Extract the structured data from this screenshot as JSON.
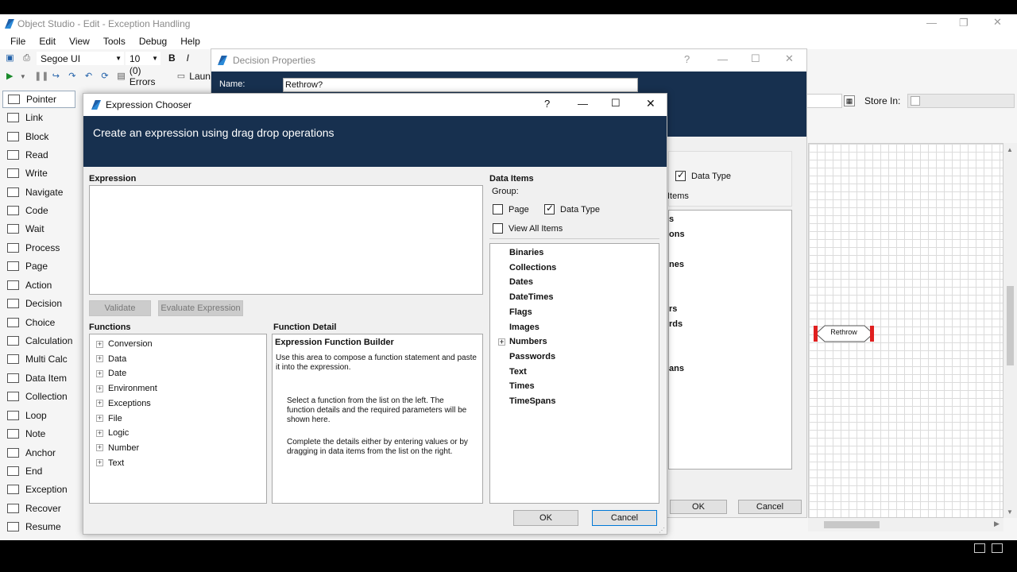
{
  "app": {
    "title": "Object Studio - Edit - Exception Handling",
    "menu": [
      "File",
      "Edit",
      "View",
      "Tools",
      "Debug",
      "Help"
    ],
    "font_name": "Segoe UI",
    "font_size": "10",
    "bold": "B",
    "italic": "I",
    "errors": "(0) Errors",
    "launch": "Laun"
  },
  "palette": [
    {
      "label": "Pointer",
      "icon": "pointer-icon",
      "selected": true
    },
    {
      "label": "Link",
      "icon": "link-icon"
    },
    {
      "label": "Block",
      "icon": "block-icon"
    },
    {
      "label": "Read",
      "icon": "read-icon"
    },
    {
      "label": "Write",
      "icon": "write-icon"
    },
    {
      "label": "Navigate",
      "icon": "navigate-icon"
    },
    {
      "label": "Code",
      "icon": "code-icon"
    },
    {
      "label": "Wait",
      "icon": "wait-icon"
    },
    {
      "label": "Process",
      "icon": "process-icon"
    },
    {
      "label": "Page",
      "icon": "page-icon"
    },
    {
      "label": "Action",
      "icon": "action-icon"
    },
    {
      "label": "Decision",
      "icon": "decision-icon"
    },
    {
      "label": "Choice",
      "icon": "choice-icon"
    },
    {
      "label": "Calculation",
      "icon": "calculation-icon"
    },
    {
      "label": "Multi Calc",
      "icon": "multi-calc-icon"
    },
    {
      "label": "Data Item",
      "icon": "data-item-icon"
    },
    {
      "label": "Collection",
      "icon": "collection-icon"
    },
    {
      "label": "Loop",
      "icon": "loop-icon"
    },
    {
      "label": "Note",
      "icon": "note-icon"
    },
    {
      "label": "Anchor",
      "icon": "anchor-icon"
    },
    {
      "label": "End",
      "icon": "end-icon"
    },
    {
      "label": "Exception",
      "icon": "exception-icon"
    },
    {
      "label": "Recover",
      "icon": "recover-icon"
    },
    {
      "label": "Resume",
      "icon": "resume-icon"
    }
  ],
  "decision": {
    "title": "Decision Properties",
    "name_label": "Name:",
    "name_value": "Rethrow?",
    "help": "?",
    "store_in": "Store In:",
    "data_type": "Data Type",
    "items_partial": "Items",
    "side_fragments": [
      "ons",
      "nes",
      "rs",
      "rds",
      "ans"
    ],
    "ok": "OK",
    "cancel": "Cancel",
    "stage_label": "Rethrow"
  },
  "chooser": {
    "title": "Expression Chooser",
    "help": "?",
    "header": "Create an expression using drag drop operations",
    "expression_label": "Expression",
    "validate": "Validate",
    "evaluate": "Evaluate Expression",
    "functions_label": "Functions",
    "functions": [
      "Conversion",
      "Data",
      "Date",
      "Environment",
      "Exceptions",
      "File",
      "Logic",
      "Number",
      "Text"
    ],
    "detail_label": "Function Detail",
    "detail_title": "Expression Function Builder",
    "detail_text1": "Use this area to compose a function statement and paste it into the expression.",
    "detail_text2": "Select a function from the list on the left. The function details and the required parameters will be shown here.",
    "detail_text3": "Complete the details either by entering values or by dragging in data items from the list on the right.",
    "data_items_label": "Data Items",
    "group_label": "Group:",
    "page_label": "Page",
    "data_type_label": "Data Type",
    "view_all_label": "View All Items",
    "data_items": [
      "Binaries",
      "Collections",
      "Dates",
      "DateTimes",
      "Flags",
      "Images",
      "Numbers",
      "Passwords",
      "Text",
      "Times",
      "TimeSpans"
    ],
    "ok": "OK",
    "cancel": "Cancel"
  },
  "colors": {
    "band": "#17304f",
    "accent": "#1f5fa8",
    "stage_marker": "#e02020"
  }
}
